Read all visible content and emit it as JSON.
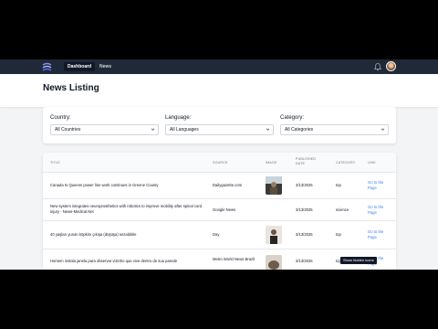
{
  "nav": {
    "links": [
      {
        "label": "Dashboard",
        "active": true
      },
      {
        "label": "News",
        "active": false
      }
    ]
  },
  "header": {
    "title": "News Listing"
  },
  "filters": {
    "country": {
      "label": "Country:",
      "value": "All Countries"
    },
    "language": {
      "label": "Language:",
      "value": "All Languages"
    },
    "category": {
      "label": "Category:",
      "value": "All Categories"
    }
  },
  "table": {
    "columns": [
      "Title",
      "Source",
      "Image",
      "Published Date",
      "Category",
      "Link"
    ],
    "rows": [
      {
        "title": "Canada to Queens power line work continues in Greene County",
        "source": "Dailygazette.com",
        "image": "person-dark",
        "date": "3/13/2025",
        "category": "top",
        "link": "Go to the Page"
      },
      {
        "title": "New system integrates neuroprosthetics with robotics to improve mobility after spinal cord injury - News-Medical.Net",
        "source": "Google News",
        "image": "",
        "date": "3/13/2025",
        "category": "science",
        "link": "Go to the Page"
      },
      {
        "title": "40 yaşları yunan köpkim çıkışa (düşüşa) sezaldıkle",
        "source": "Day",
        "image": "person-dark",
        "date": "3/13/2025",
        "category": "top",
        "link": "Go to the Page"
      },
      {
        "title": "Homem instala janela para observar vizinho que vive dentro de sua parede",
        "source": "Metro World News Brazil",
        "image": "wall-light",
        "date": "3/13/2025",
        "category": "top",
        "link": "Go to the Page"
      }
    ]
  },
  "tooltip": "Show hidden icons",
  "colors": {
    "navbar": "#1f2937",
    "link": "#3b82f6",
    "background": "#f3f4f6"
  }
}
